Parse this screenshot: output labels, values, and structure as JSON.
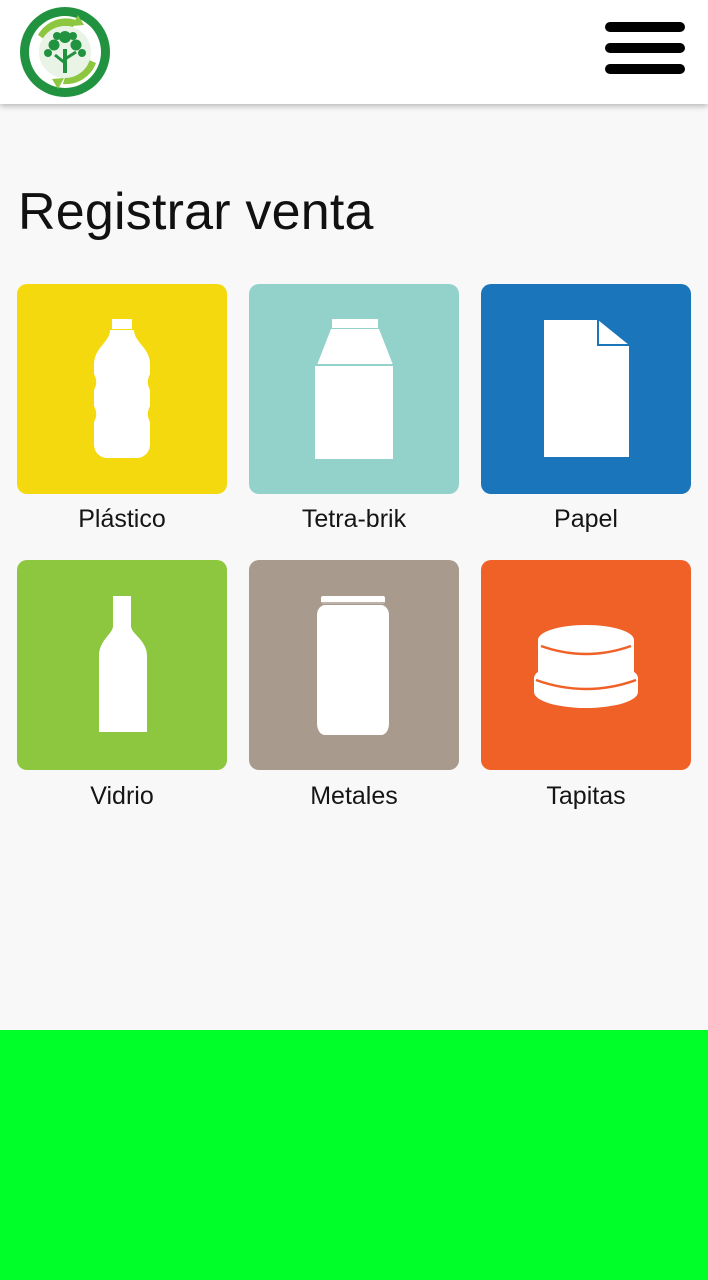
{
  "header": {
    "logo_icon": "recycle-tree-logo",
    "menu_icon": "hamburger-menu-icon"
  },
  "page": {
    "title": "Registrar venta"
  },
  "categories": [
    {
      "label": "Plástico",
      "icon": "plastic-bottle-icon",
      "color": "#f5d90f"
    },
    {
      "label": "Tetra-brik",
      "icon": "tetra-brik-carton-icon",
      "color": "#93d1cb"
    },
    {
      "label": "Papel",
      "icon": "paper-sheet-icon",
      "color": "#1b75bb"
    },
    {
      "label": "Vidrio",
      "icon": "glass-bottle-icon",
      "color": "#8dc63f"
    },
    {
      "label": "Metales",
      "icon": "metal-can-icon",
      "color": "#a89a8c"
    },
    {
      "label": "Tapitas",
      "icon": "bottle-cap-icon",
      "color": "#f06128"
    }
  ],
  "colors": {
    "background": "#f8f8f8",
    "footer_band": "#00ff29",
    "logo_green": "#21923f"
  }
}
